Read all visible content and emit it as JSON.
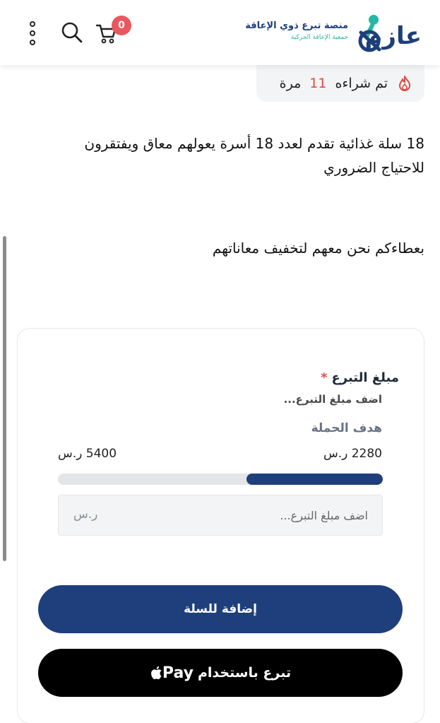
{
  "header": {
    "cart_count": "0",
    "brand_title": "منصة تبرع ذوي الإعاقة",
    "brand_subtitle": "جمعية الإعاقة الحركية",
    "brand_logo_text": "عازم"
  },
  "product": {
    "sold_prefix": "تم شراءه",
    "sold_count": "11",
    "sold_suffix": "مرة",
    "description": "18 سلة غذائية تقدم لعدد 18 أسرة يعولهم معاق ويفتقرون للاحتياج الضروري",
    "slogan": "بعطاءكم نحن معهم لتخفيف معاناتهم"
  },
  "donation": {
    "amount_label": "مبلغ التبرع",
    "required_mark": "*",
    "amount_hint": "اضف مبلغ التبرع...",
    "goal_label": "هدف الحملة",
    "raised": "2280 ر.س",
    "target": "5400 ر.س",
    "progress_fraction": 0.42,
    "input_placeholder": "اضف مبلغ التبرع...",
    "currency": "ر.س",
    "add_to_cart": "إضافة للسلة",
    "applepay_label": "تبرع باستخدام",
    "applepay_word": "Pay"
  },
  "colors": {
    "primary": "#1f3f7c",
    "accent": "#e9585e",
    "teal": "#26b7a6"
  },
  "icons": [
    "menu-dots-icon",
    "search-icon",
    "cart-icon",
    "fire-icon",
    "apple-icon"
  ]
}
